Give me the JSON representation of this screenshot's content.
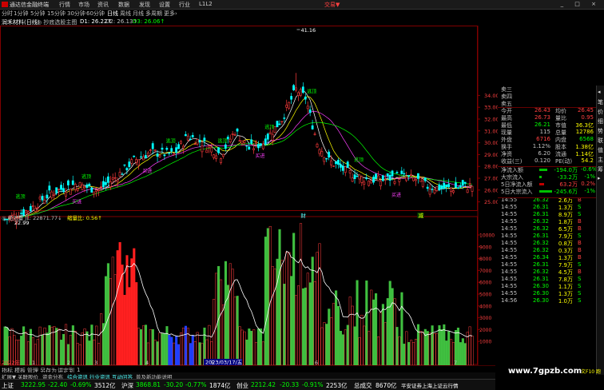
{
  "app": {
    "title": "通达信金融终端",
    "trade_label": "交易▼",
    "window_buttons": "_ □ ×"
  },
  "menu": [
    "行情",
    "市场",
    "资讯",
    "数据",
    "发现",
    "设置",
    "行业",
    "L1L2"
  ],
  "periods": [
    "分时",
    "1分钟",
    "5分钟",
    "15分钟",
    "30分钟",
    "60分钟",
    "日线",
    "周线",
    "月线",
    "多周期",
    "更多›"
  ],
  "active_period": "日线",
  "info": {
    "stock": "润禾材料(日线)",
    "indicator": "◎ 抄底选股主图",
    "ma1": "D1: 26.22↑",
    "ma2": "D2: 26.13↑",
    "ma3": "D3: 26.06↑"
  },
  "sub_info": {
    "label": "◎ 绝对量 JL: 22871.77↓",
    "vol_ratio": "缩量比: 0.56↑"
  },
  "chart_data": {
    "type": "candlestick",
    "price_ticks": [
      "34.00",
      "33.00",
      "32.00",
      "31.00",
      "30.00",
      "29.00",
      "28.00",
      "27.00",
      "26.00",
      "25.00"
    ],
    "vol_ticks": [
      "10000",
      "9000",
      "8000",
      "7000",
      "6000",
      "5000",
      "4000",
      "3000",
      "2000",
      "1000"
    ],
    "x_labels": [
      "2022年",
      "1",
      "2",
      "3",
      "4",
      "5",
      "6",
      "7"
    ],
    "cursor_date": "2023/03/17/五",
    "high_label": "41.16",
    "low_label": "22.99",
    "signal_label": "逃顶",
    "buy_label": "买进",
    "event_labels": [
      "财",
      "减"
    ],
    "colors": {
      "up": "#ff3c3c",
      "down": "#00ffff",
      "ma1": "#ffffff",
      "ma2": "#ffff00",
      "ma3": "#ff40ff",
      "ma4": "#00ff00"
    }
  },
  "quote": {
    "sell_levels": [
      "卖三",
      "卖四",
      "卖五"
    ],
    "rows": [
      {
        "a": "今开",
        "av": "26.43",
        "b": "均价",
        "bv": "26.45"
      },
      {
        "a": "最高",
        "av": "26.73",
        "b": "量比",
        "bv": "0.95"
      },
      {
        "a": "最低",
        "av": "26.21",
        "b": "市值",
        "bv": "36.3亿"
      },
      {
        "a": "现量",
        "av": "115",
        "b": "总量",
        "bv": "12786"
      },
      {
        "a": "外盘",
        "av": "6716",
        "b": "内盘",
        "bv": "6568"
      },
      {
        "a": "换手",
        "av": "1.12%",
        "b": "股本",
        "bv": "1.38亿"
      },
      {
        "a": "净资",
        "av": "6.20",
        "b": "流通",
        "bv": "1.14亿"
      },
      {
        "a": "收益(三)",
        "av": "0.120",
        "b": "PE(动)",
        "bv": "54.2"
      }
    ],
    "flows": [
      {
        "label": "净流入额",
        "value": "-194.0万",
        "pct": "-0.6%"
      },
      {
        "label": "大宗流入",
        "value": "-33.2万",
        "pct": "-1%"
      },
      {
        "label": "5日净流入额",
        "value": "63.2万",
        "pct": "0.2%"
      },
      {
        "label": "5日大宗流入",
        "value": "-245.6万",
        "pct": "-1%"
      }
    ],
    "ticks": [
      {
        "t": "14:55",
        "p": "26.32",
        "v": "2.6万",
        "d": "B"
      },
      {
        "t": "14:55",
        "p": "26.31",
        "p2": "",
        "v": "1.3万",
        "d": "S"
      },
      {
        "t": "14:55",
        "p": "26.31",
        "v": "8.9万",
        "d": "S"
      },
      {
        "t": "14:55",
        "p": "26.32",
        "v": "1.8万",
        "d": "B"
      },
      {
        "t": "14:55",
        "p": "26.32",
        "v": "6.5万",
        "d": "B"
      },
      {
        "t": "14:55",
        "p": "26.31",
        "v": "7.9万",
        "d": "S"
      },
      {
        "t": "14:55",
        "p": "26.32",
        "v": "0.8万",
        "d": "B"
      },
      {
        "t": "14:55",
        "p": "26.32",
        "v": "0.3万",
        "d": "B"
      },
      {
        "t": "14:55",
        "p": "26.34",
        "v": "1.3万",
        "d": "B"
      },
      {
        "t": "14:55",
        "p": "26.31",
        "v": "7.9万",
        "d": "S"
      },
      {
        "t": "14:55",
        "p": "26.32",
        "v": "4.5万",
        "d": "B"
      },
      {
        "t": "14:55",
        "p": "26.31",
        "v": "7.8万",
        "d": "S"
      },
      {
        "t": "14:55",
        "p": "26.30",
        "v": "1.1万",
        "d": "S"
      },
      {
        "t": "14:55",
        "p": "26.30",
        "v": "1.3万",
        "d": "S"
      },
      {
        "t": "14:56",
        "p": "26.30",
        "v": "1.0万",
        "d": "S"
      }
    ]
  },
  "scroll_buttons": [
    "◂",
    "笔",
    "价",
    "细",
    "势",
    "联",
    "值",
    "主",
    "筹",
    "▸"
  ],
  "bottom_tabs": [
    "指标",
    "模板",
    "管理",
    "另存为",
    "讲定到",
    "1"
  ],
  "status_tabs": [
    "扩展▼",
    "关联股价",
    "资金分布",
    "综合资讯",
    "行业资讯",
    "互动问答",
    "普及新功能说明"
  ],
  "index": [
    {
      "name": "上证",
      "val": "3222.95",
      "chg": "-22.40",
      "pct": "-0.69%",
      "amt": "3512亿"
    },
    {
      "name": "沪深",
      "val": "3868.81",
      "chg": "-30.20",
      "pct": "-0.77%",
      "amt": "1874亿"
    },
    {
      "name": "创业",
      "val": "2212.42",
      "chg": "-20.33",
      "pct": "-0.91%",
      "amt": "2253亿"
    }
  ],
  "deal": {
    "label": "总成交",
    "value": "8670亿"
  },
  "news": "平安证券上海上证云行情",
  "footer_right": "图文F10 跑",
  "watermark": "www.7gpzb.com"
}
